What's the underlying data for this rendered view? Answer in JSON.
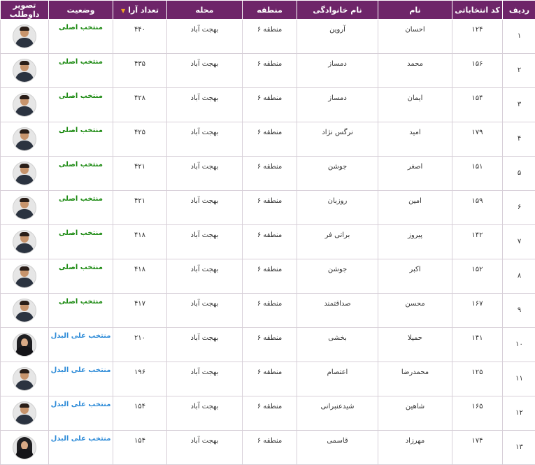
{
  "headers": {
    "row": "ردیف",
    "code": "کد انتخاباتی",
    "first_name": "نام",
    "last_name": "نام خانوادگی",
    "region": "منطقه",
    "area": "محله",
    "votes": "تعداد آرا",
    "status": "وضعیت",
    "photo": "تصویر داوطلب"
  },
  "sort_column": "votes",
  "status_colors": {
    "main": "#1c8a12",
    "alternate": "#2f8cd8"
  },
  "rows": [
    {
      "row": "۱",
      "code": "۱۲۴",
      "first_name": "احسان",
      "last_name": "آروین",
      "region": "منطقه ۶",
      "area": "بهجت آباد",
      "votes": "۴۴۰",
      "status": "منتخب اصلی",
      "status_type": "main",
      "photo": "candidate-photo-male"
    },
    {
      "row": "۲",
      "code": "۱۵۶",
      "first_name": "محمد",
      "last_name": "دمساز",
      "region": "منطقه ۶",
      "area": "بهجت آباد",
      "votes": "۴۳۵",
      "status": "منتخب اصلی",
      "status_type": "main",
      "photo": "candidate-photo-male"
    },
    {
      "row": "۳",
      "code": "۱۵۴",
      "first_name": "ایمان",
      "last_name": "دمساز",
      "region": "منطقه ۶",
      "area": "بهجت آباد",
      "votes": "۴۲۸",
      "status": "منتخب اصلی",
      "status_type": "main",
      "photo": "candidate-photo-male"
    },
    {
      "row": "۴",
      "code": "۱۷۹",
      "first_name": "امید",
      "last_name": "نرگس نژاد",
      "region": "منطقه ۶",
      "area": "بهجت آباد",
      "votes": "۴۲۵",
      "status": "منتخب اصلی",
      "status_type": "main",
      "photo": "candidate-photo-male"
    },
    {
      "row": "۵",
      "code": "۱۵۱",
      "first_name": "اصغر",
      "last_name": "جوشن",
      "region": "منطقه ۶",
      "area": "بهجت آباد",
      "votes": "۴۲۱",
      "status": "منتخب اصلی",
      "status_type": "main",
      "photo": "candidate-photo-male"
    },
    {
      "row": "۶",
      "code": "۱۵۹",
      "first_name": "امین",
      "last_name": "روزبان",
      "region": "منطقه ۶",
      "area": "بهجت آباد",
      "votes": "۴۲۱",
      "status": "منتخب اصلی",
      "status_type": "main",
      "photo": "candidate-photo-male"
    },
    {
      "row": "۷",
      "code": "۱۴۲",
      "first_name": "پیروز",
      "last_name": "براتی فر",
      "region": "منطقه ۶",
      "area": "بهجت آباد",
      "votes": "۴۱۸",
      "status": "منتخب اصلی",
      "status_type": "main",
      "photo": "candidate-photo-male"
    },
    {
      "row": "۸",
      "code": "۱۵۲",
      "first_name": "اکبر",
      "last_name": "جوشن",
      "region": "منطقه ۶",
      "area": "بهجت آباد",
      "votes": "۴۱۸",
      "status": "منتخب اصلی",
      "status_type": "main",
      "photo": "candidate-photo-male"
    },
    {
      "row": "۹",
      "code": "۱۶۷",
      "first_name": "محسن",
      "last_name": "صداقتمند",
      "region": "منطقه ۶",
      "area": "بهجت آباد",
      "votes": "۴۱۷",
      "status": "منتخب اصلی",
      "status_type": "main",
      "photo": "candidate-photo-male"
    },
    {
      "row": "۱۰",
      "code": "۱۴۱",
      "first_name": "حمیلا",
      "last_name": "بخشی",
      "region": "منطقه ۶",
      "area": "بهجت آباد",
      "votes": "۲۱۰",
      "status": "منتخب علی البدل",
      "status_type": "alternate",
      "photo": "candidate-photo-female"
    },
    {
      "row": "۱۱",
      "code": "۱۲۵",
      "first_name": "محمدرضا",
      "last_name": "اعتصام",
      "region": "منطقه ۶",
      "area": "بهجت آباد",
      "votes": "۱۹۶",
      "status": "منتخب علی البدل",
      "status_type": "alternate",
      "photo": "candidate-photo-male"
    },
    {
      "row": "۱۲",
      "code": "۱۶۵",
      "first_name": "شاهین",
      "last_name": "شیدعنبرانی",
      "region": "منطقه ۶",
      "area": "بهجت آباد",
      "votes": "۱۵۴",
      "status": "منتخب علی البدل",
      "status_type": "alternate",
      "photo": "candidate-photo-male"
    },
    {
      "row": "۱۳",
      "code": "۱۷۴",
      "first_name": "مهرزاد",
      "last_name": "قاسمی",
      "region": "منطقه ۶",
      "area": "بهجت آباد",
      "votes": "۱۵۴",
      "status": "منتخب علی البدل",
      "status_type": "alternate",
      "photo": "candidate-photo-female"
    }
  ]
}
